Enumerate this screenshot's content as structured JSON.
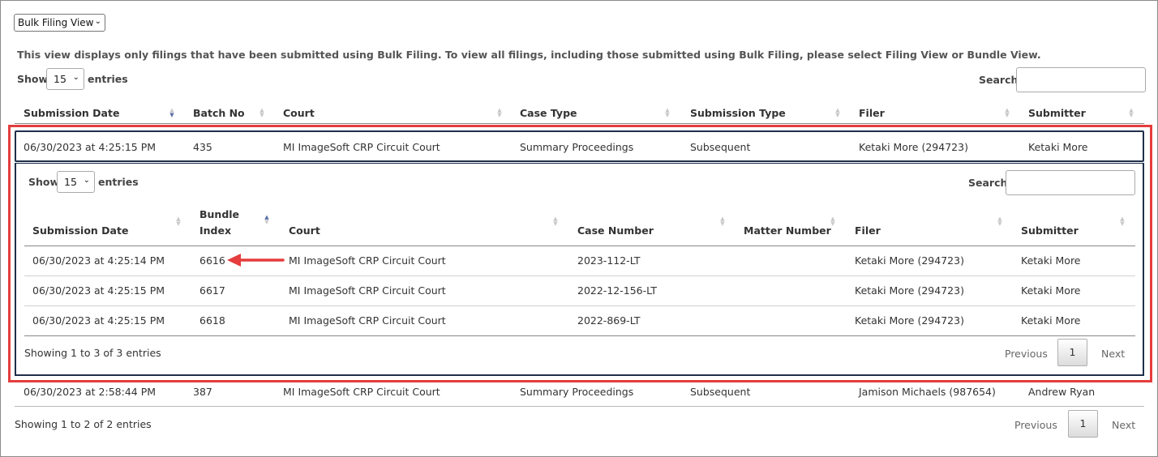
{
  "view_select": {
    "value": "Bulk Filing View",
    "chevron_icon": "chevron-down-icon"
  },
  "notice": "This view displays only filings that have been submitted using Bulk Filing. To view all filings, including those submitted using Bulk Filing, please select Filing View or Bundle View.",
  "outer": {
    "show_label": "Show",
    "entries_value": "15",
    "entries_label": "entries",
    "search_label": "Search:",
    "search_value": "",
    "columns": [
      "Submission Date",
      "Batch No",
      "Court",
      "Case Type",
      "Submission Type",
      "Filer",
      "Submitter"
    ],
    "rows": [
      [
        "06/30/2023 at 4:25:15 PM",
        "435",
        "MI ImageSoft CRP Circuit Court",
        "Summary Proceedings",
        "Subsequent",
        "Ketaki More (294723)",
        "Ketaki More"
      ],
      [
        "06/30/2023 at 2:58:44 PM",
        "387",
        "MI ImageSoft CRP Circuit Court",
        "Summary Proceedings",
        "Subsequent",
        "Jamison Michaels (987654)",
        "Andrew Ryan"
      ]
    ],
    "info": "Showing 1 to 2 of 2 entries",
    "pagination": {
      "previous": "Previous",
      "current": "1",
      "next": "Next"
    }
  },
  "inner": {
    "show_label": "Show",
    "entries_value": "15",
    "entries_label": "entries",
    "search_label": "Search:",
    "search_value": "",
    "columns": [
      "Submission Date",
      "Bundle Index",
      "Court",
      "Case Number",
      "Matter Number",
      "Filer",
      "Submitter"
    ],
    "bundle_header_line1": "Bundle",
    "bundle_header_line2": "Index",
    "rows": [
      [
        "06/30/2023 at 4:25:14 PM",
        "6616",
        "MI ImageSoft CRP Circuit Court",
        "2023-112-LT",
        "",
        "Ketaki More (294723)",
        "Ketaki More"
      ],
      [
        "06/30/2023 at 4:25:15 PM",
        "6617",
        "MI ImageSoft CRP Circuit Court",
        "2022-12-156-LT",
        "",
        "Ketaki More (294723)",
        "Ketaki More"
      ],
      [
        "06/30/2023 at 4:25:15 PM",
        "6618",
        "MI ImageSoft CRP Circuit Court",
        "2022-869-LT",
        "",
        "Ketaki More (294723)",
        "Ketaki More"
      ]
    ],
    "info": "Showing 1 to 3 of 3 entries",
    "pagination": {
      "previous": "Previous",
      "current": "1",
      "next": "Next"
    }
  },
  "annotation": {
    "highlight_color": "#e53d3d",
    "arrow_icon": "arrow-left-icon"
  },
  "colors": {
    "row_outline": "#1f2f4a",
    "sort_active": "#5a6fa8"
  }
}
